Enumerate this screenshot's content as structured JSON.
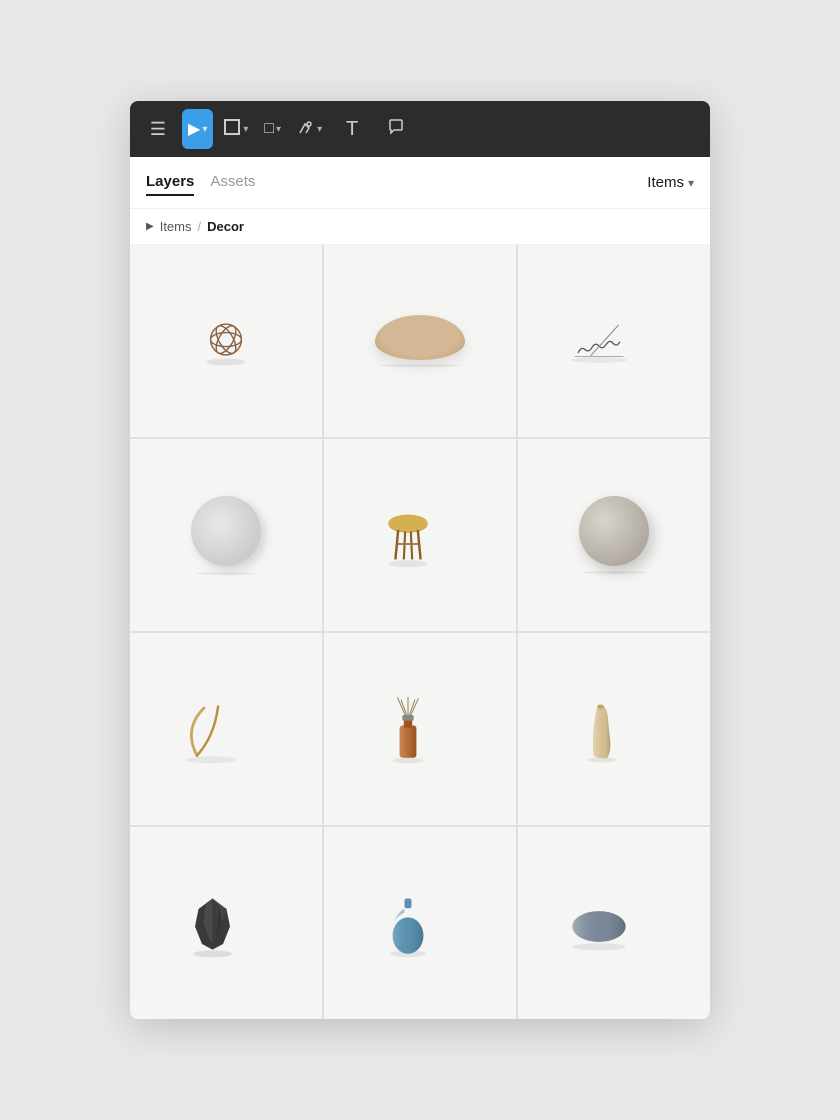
{
  "toolbar": {
    "menu_icon": "☰",
    "select_tool": "▶",
    "frame_tool": "#",
    "rect_tool": "□",
    "pen_tool": "✒",
    "text_tool": "T",
    "comment_tool": "○",
    "chevron": "▾"
  },
  "panel": {
    "tabs": [
      {
        "id": "layers",
        "label": "Layers",
        "active": true
      },
      {
        "id": "assets",
        "label": "Assets",
        "active": false
      }
    ],
    "items_dropdown": "Items",
    "items_chevron": "▾"
  },
  "breadcrumb": {
    "triangle": "▶",
    "parent": "Items",
    "separator": "/",
    "current": "Decor"
  },
  "grid": {
    "items": [
      {
        "id": "item-1",
        "type": "orb",
        "alt": "Decorative metal orb"
      },
      {
        "id": "item-2",
        "type": "cushion",
        "alt": "Round cushion"
      },
      {
        "id": "item-3",
        "type": "incense",
        "alt": "Incense sticks"
      },
      {
        "id": "item-4",
        "type": "disk",
        "alt": "White disk"
      },
      {
        "id": "item-5",
        "type": "stool",
        "alt": "Wicker stool"
      },
      {
        "id": "item-6",
        "type": "sphere",
        "alt": "Concrete sphere"
      },
      {
        "id": "item-7",
        "type": "stick",
        "alt": "Decorative stick"
      },
      {
        "id": "item-8",
        "type": "diffuser",
        "alt": "Reed diffuser"
      },
      {
        "id": "item-9",
        "type": "vase-tall",
        "alt": "Tall ceramic vase"
      },
      {
        "id": "item-10",
        "type": "vase-dark",
        "alt": "Dark geometric vase"
      },
      {
        "id": "item-11",
        "type": "vase-blue",
        "alt": "Blue glass vase"
      },
      {
        "id": "item-12",
        "type": "vase-oval",
        "alt": "Grey oval vase"
      }
    ]
  },
  "colors": {
    "toolbar_bg": "#2c2c2c",
    "active_tool": "#3b9fe8",
    "panel_bg": "#ffffff",
    "grid_gap": "#e0e0e0",
    "cell_bg": "#f5f5f3"
  }
}
